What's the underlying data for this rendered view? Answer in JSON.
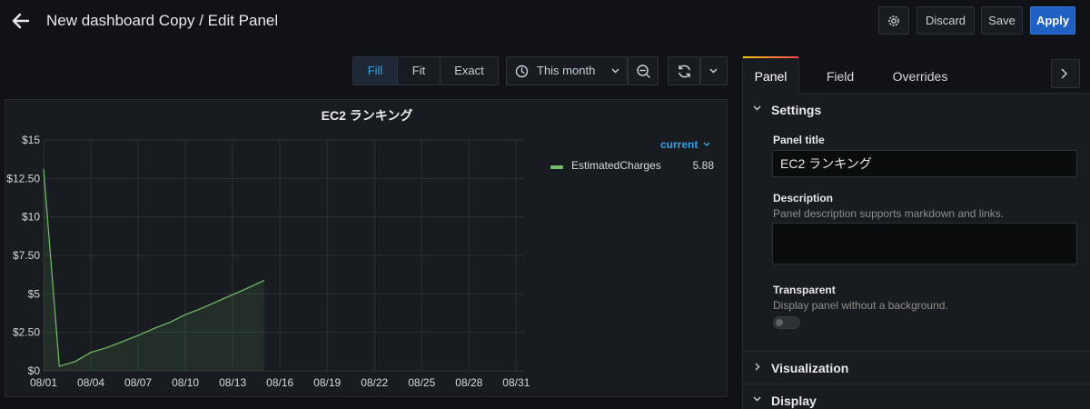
{
  "header": {
    "title": "New dashboard Copy / Edit Panel",
    "discard_label": "Discard",
    "save_label": "Save",
    "apply_label": "Apply"
  },
  "toolbar": {
    "fit_modes": [
      "Fill",
      "Fit",
      "Exact"
    ],
    "active_fit_mode": "Fill",
    "time_range": "This month"
  },
  "panel": {
    "title": "EC2 ランキング",
    "legend": {
      "sort_label": "current",
      "items": [
        {
          "name": "EstimatedCharges",
          "value": "5.88",
          "color": "#73bf69"
        }
      ]
    }
  },
  "chart_data": {
    "type": "area",
    "x": [
      "08/01",
      "08/02",
      "08/03",
      "08/04",
      "08/05",
      "08/06",
      "08/07",
      "08/08",
      "08/09",
      "08/10",
      "08/11",
      "08/12",
      "08/13",
      "08/14",
      "08/15"
    ],
    "series": [
      {
        "name": "EstimatedCharges",
        "color": "#73bf69",
        "values": [
          13.1,
          0.3,
          0.6,
          1.2,
          1.5,
          1.9,
          2.3,
          2.75,
          3.15,
          3.65,
          4.05,
          4.5,
          4.95,
          5.4,
          5.88
        ]
      }
    ],
    "x_tick_labels": [
      "08/01",
      "08/04",
      "08/07",
      "08/10",
      "08/13",
      "08/16",
      "08/19",
      "08/22",
      "08/25",
      "08/28",
      "08/31"
    ],
    "y_tick_labels": [
      "$0",
      "$2.50",
      "$5",
      "$7.50",
      "$10",
      "$12.50",
      "$15"
    ],
    "ylim": [
      0,
      15
    ],
    "xlim_days": [
      1,
      31.5
    ],
    "grid": true
  },
  "options": {
    "tabs": [
      "Panel",
      "Field",
      "Overrides"
    ],
    "active_tab": "Panel",
    "settings": {
      "header": "Settings",
      "panel_title_label": "Panel title",
      "panel_title_value": "EC2 ランキング",
      "description_label": "Description",
      "description_hint": "Panel description supports markdown and links.",
      "description_value": "",
      "transparent_label": "Transparent",
      "transparent_hint": "Display panel without a background.",
      "transparent_on": false
    },
    "sections": [
      "Visualization",
      "Display"
    ]
  },
  "theme": {
    "accent": "#33a2e5",
    "primary_button": "#1f60c4",
    "series": "#73bf69"
  }
}
